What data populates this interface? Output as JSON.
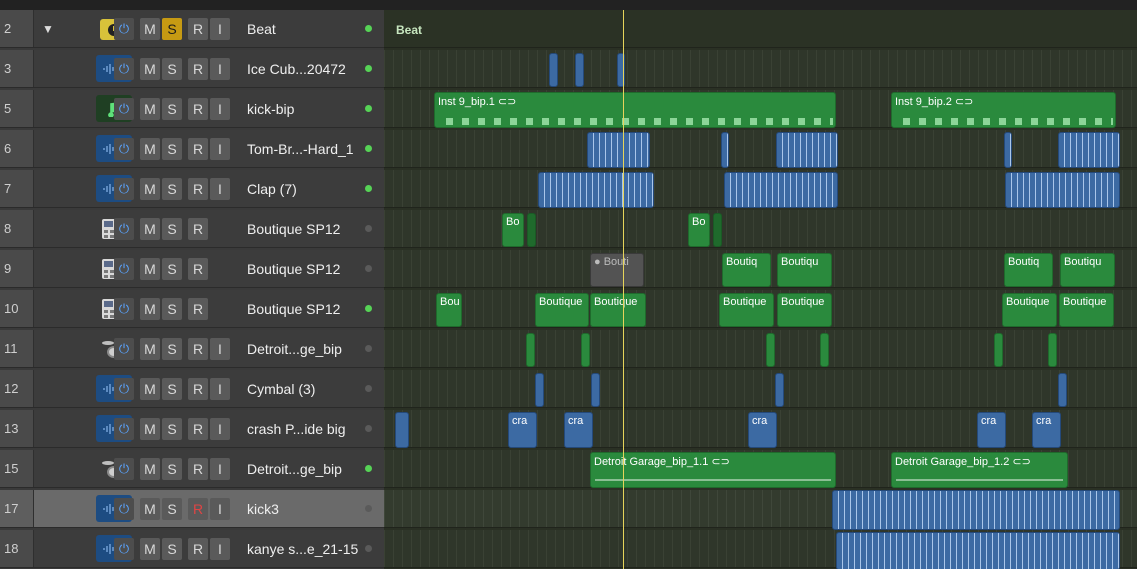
{
  "tracks": [
    {
      "num": "2",
      "name": "Beat",
      "kind": "stack",
      "led": "on",
      "solo": true,
      "rec": true,
      "input": true
    },
    {
      "num": "3",
      "name": "Ice Cub...20472",
      "kind": "audio",
      "led": "on",
      "rec": true,
      "input": true
    },
    {
      "num": "5",
      "name": "kick-bip",
      "kind": "midi",
      "led": "on",
      "rec": true,
      "input": true
    },
    {
      "num": "6",
      "name": "Tom-Br...-Hard_1",
      "kind": "audio",
      "led": "on",
      "rec": true,
      "input": true
    },
    {
      "num": "7",
      "name": "Clap (7)",
      "kind": "audio",
      "led": "on",
      "rec": true,
      "input": true
    },
    {
      "num": "8",
      "name": "Boutique SP12",
      "kind": "sampler",
      "led": "off",
      "rec": true,
      "input": false
    },
    {
      "num": "9",
      "name": "Boutique SP12",
      "kind": "sampler",
      "led": "off",
      "rec": true,
      "input": false
    },
    {
      "num": "10",
      "name": "Boutique SP12",
      "kind": "sampler",
      "led": "on",
      "rec": true,
      "input": false
    },
    {
      "num": "11",
      "name": "Detroit...ge_bip",
      "kind": "drum",
      "led": "off",
      "rec": true,
      "input": true
    },
    {
      "num": "12",
      "name": "Cymbal (3)",
      "kind": "audio",
      "led": "off",
      "rec": true,
      "input": true
    },
    {
      "num": "13",
      "name": "crash P...ide big",
      "kind": "audio",
      "led": "off",
      "rec": true,
      "input": true
    },
    {
      "num": "15",
      "name": "Detroit...ge_bip",
      "kind": "drum",
      "led": "on",
      "rec": true,
      "input": true
    },
    {
      "num": "17",
      "name": "kick3",
      "kind": "audio",
      "led": "off",
      "rec": true,
      "recArmed": true,
      "input": true,
      "selected": true
    },
    {
      "num": "18",
      "name": "kanye s...e_21-15",
      "kind": "audio",
      "led": "off",
      "rec": true,
      "input": true
    }
  ],
  "buttons": {
    "mute": "M",
    "solo": "S",
    "record": "R",
    "input": "I",
    "power": "⏻"
  },
  "stack_arrow": "▼",
  "beat_label": "Beat",
  "regions": {
    "inst1": "Inst 9_bip.1 ⊂⊃",
    "inst2": "Inst 9_bip.2 ⊂⊃",
    "bo": "Bo",
    "bouti_gray": "● Bouti",
    "boutiq": "Boutiq",
    "boutiqu": "Boutiqu",
    "bou": "Bou",
    "boutique": "Boutique",
    "cra": "cra",
    "detroit1": "Detroit Garage_bip_1.1 ⊂⊃",
    "detroit2": "Detroit Garage_bip_1.2 ⊂⊃"
  },
  "colors": {
    "green_region": "#2a8a3d",
    "blue_region": "#3c6aa3",
    "solo": "#c69a13",
    "playhead": "#e6d45a"
  }
}
